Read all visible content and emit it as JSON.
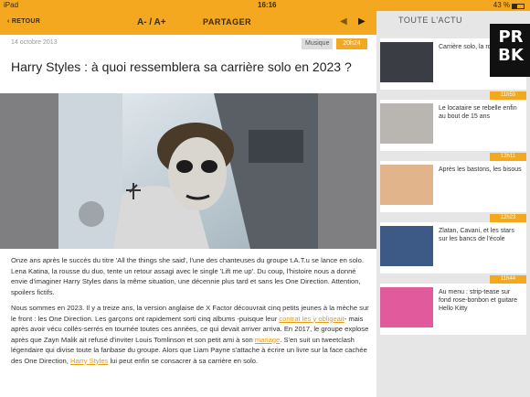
{
  "status_bar": {
    "carrier": "iPad",
    "time": "16:16",
    "battery": "43 %"
  },
  "toolbar": {
    "back_label": "RETOUR",
    "font_size_label": "A- / A+",
    "share_label": "PARTAGER",
    "prev_icon": "chevron-left-icon",
    "next_icon": "chevron-right-icon"
  },
  "article": {
    "date": "14 octobre 2013",
    "category": "Musique",
    "time": "20h24",
    "title": "Harry Styles : à quoi ressemblera sa carrière solo en 2023 ?",
    "paragraph1": "Onze ans après le succès du titre 'All the things she said', l'une des chanteuses du groupe t.A.T.u se lance en solo. Lena Katina, la rousse du duo, tente un retour assagi avec le single 'Lift me up'. Du coup, l'histoire nous a donné envie d'imaginer Harry Styles dans la même situation, une décennie plus tard et sans les One Direction. Attention, spoilers fictifs.",
    "p2_a": "Nous sommes en 2023. Il y a treize ans, la version anglaise de X Factor découvrait cinq petits jeunes à la mèche sur le front : les One Direction. Les garçons ont rapidement sorti cinq albums -puisque leur ",
    "p2_link1": "contrat les y obligeait",
    "p2_b": "- mais après avoir vécu collés-serrés en tournée toutes ces années, ce qui devait arriver arriva. En 2017, le groupe explose après que Zayn Malik ait refusé d'inviter Louis Tomlinson et son petit ami à son ",
    "p2_link2": "mariage",
    "p2_c": ". S'en suit un tweetclash légendaire qui divise toute la fanbase du groupe. Alors que Liam Payne s'attache à écrire un livre sur la face cachée des One Direction, ",
    "p2_link3": "Harry Styles",
    "p2_d": " lui peut enfin se consacrer à sa carrière en solo."
  },
  "sidebar": {
    "title": "TOUTE L'ACTU",
    "logo_lines": [
      "PR",
      "BK"
    ],
    "items": [
      {
        "time": "",
        "text": "Carrière solo, la rock et haine",
        "thumb_color": "#3a3d44"
      },
      {
        "time": "11h59",
        "text": "Le locataire se rebelle enfin au bout de 15 ans",
        "thumb_color": "#b9b6b2"
      },
      {
        "time": "12h11",
        "text": "Après les bastons, les bisous",
        "thumb_color": "#e2b48c"
      },
      {
        "time": "12h23",
        "text": "Zlatan, Cavani, et les stars sur les bancs de l'école",
        "thumb_color": "#3d5a86"
      },
      {
        "time": "11h44",
        "text": "Au menu : strip-tease sur fond rose-bonbon et guitare Hello Kitty",
        "thumb_color": "#e15a9c"
      }
    ]
  },
  "colors": {
    "accent": "#f3a81f",
    "link": "#e59a12"
  }
}
